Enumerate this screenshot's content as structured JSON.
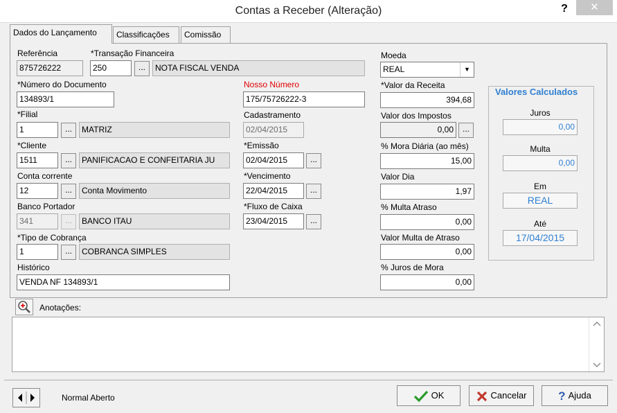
{
  "window": {
    "title": "Contas a Receber (Alteração)",
    "help_label": "?",
    "close_label": "✕"
  },
  "tabs": [
    {
      "label": "Dados do Lançamento"
    },
    {
      "label": "Classificações"
    },
    {
      "label": "Comissão"
    }
  ],
  "form": {
    "referencia": {
      "label": "Referência",
      "value": "875726222"
    },
    "transacao": {
      "label": "*Transação Financeira",
      "code": "250",
      "desc": "NOTA FISCAL VENDA"
    },
    "numero_documento": {
      "label": "*Número do Documento",
      "value": "134893/1"
    },
    "nosso_numero": {
      "label": "Nosso Número",
      "value": "175/75726222-3"
    },
    "filial": {
      "label": "*Filial",
      "code": "1",
      "desc": "MATRIZ"
    },
    "cadastramento": {
      "label": "Cadastramento",
      "value": "02/04/2015"
    },
    "cliente": {
      "label": "*Cliente",
      "code": "1511",
      "desc": "PANIFICACAO E CONFEITARIA JU"
    },
    "emissao": {
      "label": "*Emissão",
      "value": "02/04/2015"
    },
    "conta_corrente": {
      "label": "Conta corrente",
      "code": "12",
      "desc": "Conta Movimento"
    },
    "vencimento": {
      "label": "*Vencimento",
      "value": "22/04/2015"
    },
    "banco_portador": {
      "label": "Banco Portador",
      "code": "341",
      "desc": "BANCO ITAU"
    },
    "fluxo_caixa": {
      "label": "*Fluxo de Caixa",
      "value": "23/04/2015"
    },
    "tipo_cobranca": {
      "label": "*Tipo de Cobrança",
      "code": "1",
      "desc": "COBRANCA SIMPLES"
    },
    "historico": {
      "label": "Histórico",
      "value": "VENDA NF 134893/1"
    },
    "moeda": {
      "label": "Moeda",
      "value": "REAL"
    },
    "valor_receita": {
      "label": "*Valor da Receita",
      "value": "394,68"
    },
    "valor_impostos": {
      "label": "Valor dos Impostos",
      "value": "0,00"
    },
    "mora_diaria": {
      "label": "% Mora Diária (ao mês)",
      "value": "15,00"
    },
    "valor_dia": {
      "label": "Valor Dia",
      "value": "1,97"
    },
    "multa_atraso": {
      "label": "% Multa Atraso",
      "value": "0,00"
    },
    "valor_multa_atraso": {
      "label": "Valor Multa de Atraso",
      "value": "0,00"
    },
    "juros_mora": {
      "label": "% Juros de Mora",
      "value": "0,00"
    },
    "dots_label": "..."
  },
  "valores_calculados": {
    "title": "Valores Calculados",
    "juros": {
      "label": "Juros",
      "value": "0,00"
    },
    "multa": {
      "label": "Multa",
      "value": "0,00"
    },
    "em": {
      "label": "Em",
      "value": "REAL"
    },
    "ate": {
      "label": "Até",
      "value": "17/04/2015"
    }
  },
  "notes": {
    "label": "Anotações:",
    "value": ""
  },
  "status": {
    "text": "Normal Aberto"
  },
  "buttons": {
    "ok": "OK",
    "cancel": "Cancelar",
    "help": "Ajuda"
  },
  "colors": {
    "accent_blue": "#2f7fd0",
    "required_red": "#e00000",
    "ok_green": "#2a9a2a",
    "cancel_red": "#c0392b"
  }
}
